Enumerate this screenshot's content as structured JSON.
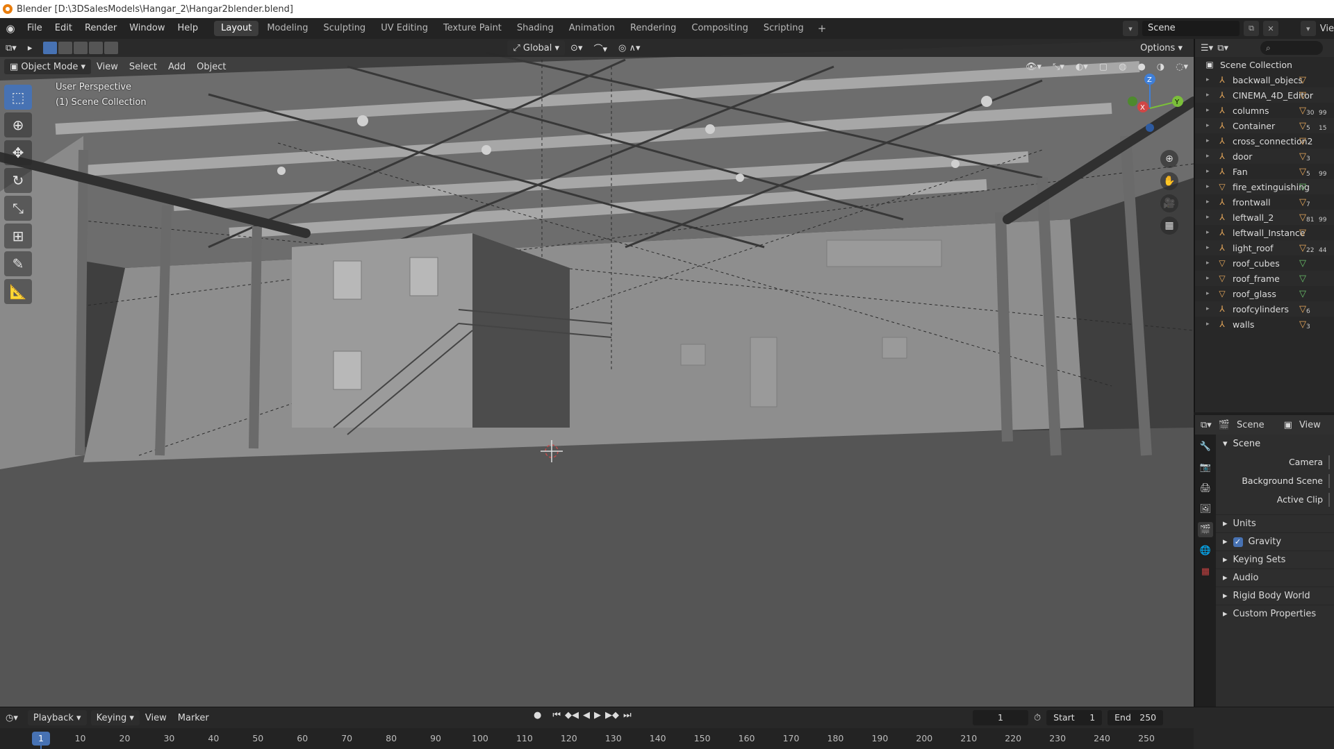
{
  "window": {
    "title": "Blender [D:\\3DSalesModels\\Hangar_2\\Hangar2blender.blend]"
  },
  "menu": {
    "items": [
      "File",
      "Edit",
      "Render",
      "Window",
      "Help"
    ],
    "workspaces": [
      "Layout",
      "Modeling",
      "Sculpting",
      "UV Editing",
      "Texture Paint",
      "Shading",
      "Animation",
      "Rendering",
      "Compositing",
      "Scripting"
    ],
    "active_workspace": "Layout",
    "scene_name": "Scene",
    "view_layer_cut": "Vie"
  },
  "viewport": {
    "mode": "Object Mode",
    "menus": [
      "View",
      "Select",
      "Add",
      "Object"
    ],
    "transform_orientation": "Global",
    "options_label": "Options",
    "overlay_line1": "User Perspective",
    "overlay_line2": "(1) Scene Collection",
    "tools": [
      "select-box-tool",
      "cursor-tool",
      "move-tool",
      "rotate-tool",
      "scale-tool",
      "transform-tool",
      "annotate-tool",
      "measure-tool"
    ],
    "gizmo": {
      "z": "Z",
      "y": "Y",
      "x": "X"
    }
  },
  "outliner": {
    "root": "Scene Collection",
    "items": [
      {
        "name": "backwall_objecs",
        "icon": "empty"
      },
      {
        "name": "CINEMA_4D_Editor",
        "icon": "empty"
      },
      {
        "name": "columns",
        "icon": "empty",
        "badges": [
          "30",
          "99"
        ]
      },
      {
        "name": "Container",
        "icon": "empty",
        "badges": [
          "5",
          "15"
        ]
      },
      {
        "name": "cross_connection2",
        "icon": "empty"
      },
      {
        "name": "door",
        "icon": "empty",
        "badges": [
          "3"
        ]
      },
      {
        "name": "Fan",
        "icon": "empty",
        "badges": [
          "5",
          "99"
        ]
      },
      {
        "name": "fire_extinguishing",
        "icon": "mesh"
      },
      {
        "name": "frontwall",
        "icon": "empty",
        "badges": [
          "7"
        ]
      },
      {
        "name": "leftwall_2",
        "icon": "empty",
        "badges": [
          "81",
          "99"
        ]
      },
      {
        "name": "leftwall_Instance",
        "icon": "empty"
      },
      {
        "name": "light_roof",
        "icon": "empty",
        "badges": [
          "22",
          "44"
        ]
      },
      {
        "name": "roof_cubes",
        "icon": "mesh"
      },
      {
        "name": "roof_frame",
        "icon": "mesh"
      },
      {
        "name": "roof_glass",
        "icon": "mesh"
      },
      {
        "name": "roofcylinders",
        "icon": "empty",
        "badges": [
          "6"
        ]
      },
      {
        "name": "walls",
        "icon": "empty",
        "badges": [
          "3"
        ]
      }
    ]
  },
  "properties": {
    "header_scene": "Scene",
    "header_view": "View",
    "panel_title": "Scene",
    "rows": [
      "Camera",
      "Background Scene",
      "Active Clip"
    ],
    "subpanels": [
      "Units",
      "Gravity",
      "Keying Sets",
      "Audio",
      "Rigid Body World",
      "Custom Properties"
    ],
    "gravity_checked": true
  },
  "timeline": {
    "menus": [
      "Playback",
      "Keying",
      "View",
      "Marker"
    ],
    "current_frame": "1",
    "start_label": "Start",
    "start_value": "1",
    "end_label": "End",
    "end_value": "250",
    "ticks": [
      "1",
      "10",
      "20",
      "30",
      "40",
      "50",
      "60",
      "70",
      "80",
      "90",
      "100",
      "110",
      "120",
      "130",
      "140",
      "150",
      "160",
      "170",
      "180",
      "190",
      "200",
      "210",
      "220",
      "230",
      "240",
      "250"
    ]
  },
  "colors": {
    "accent": "#4772b3",
    "empty_icon": "#e8a95b",
    "mesh_icon": "#6ac06a"
  }
}
